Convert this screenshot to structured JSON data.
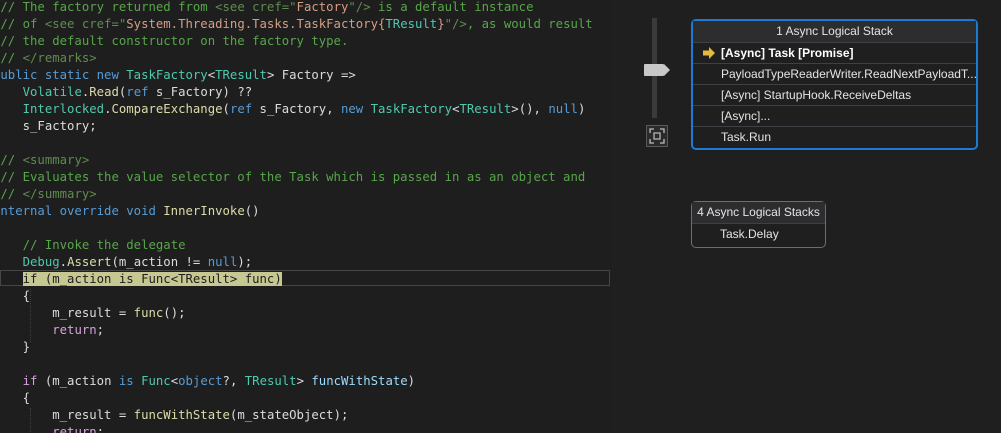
{
  "editor": {
    "lines": [
      {
        "indent": "",
        "tokens": [
          [
            "comment",
            "/// The factory returned from "
          ],
          [
            "xmltag",
            "<see cref=\""
          ],
          [
            "string",
            "Factory"
          ],
          [
            "xmltag",
            "\"/>"
          ],
          [
            "comment",
            " is a default instance"
          ]
        ]
      },
      {
        "indent": "",
        "tokens": [
          [
            "comment",
            "/// of "
          ],
          [
            "xmltag",
            "<see cref=\""
          ],
          [
            "string",
            "System.Threading.Tasks.TaskFactory{"
          ],
          [
            "type",
            "TResult"
          ],
          [
            "string",
            "}"
          ],
          [
            "xmltag",
            "\"/>"
          ],
          [
            "comment",
            ", as would result"
          ]
        ]
      },
      {
        "indent": "",
        "tokens": [
          [
            "comment",
            "/// the default constructor on the factory type."
          ]
        ]
      },
      {
        "indent": "",
        "tokens": [
          [
            "comment",
            "/// "
          ],
          [
            "xmltag",
            "</remarks>"
          ]
        ]
      },
      {
        "indent": "",
        "tokens": [
          [
            "kw",
            "public static new "
          ],
          [
            "type",
            "TaskFactory"
          ],
          [
            "plain",
            "<"
          ],
          [
            "type",
            "TResult"
          ],
          [
            "plain",
            "> Factory =>"
          ]
        ]
      },
      {
        "indent": "    ",
        "tokens": [
          [
            "type",
            "Volatile"
          ],
          [
            "plain",
            "."
          ],
          [
            "method",
            "Read"
          ],
          [
            "plain",
            "("
          ],
          [
            "kw",
            "ref"
          ],
          [
            "plain",
            " s_Factory) ??"
          ]
        ]
      },
      {
        "indent": "    ",
        "tokens": [
          [
            "type",
            "Interlocked"
          ],
          [
            "plain",
            "."
          ],
          [
            "method",
            "CompareExchange"
          ],
          [
            "plain",
            "("
          ],
          [
            "kw",
            "ref"
          ],
          [
            "plain",
            " s_Factory, "
          ],
          [
            "kw",
            "new "
          ],
          [
            "type",
            "TaskFactory"
          ],
          [
            "plain",
            "<"
          ],
          [
            "type",
            "TResult"
          ],
          [
            "plain",
            ">(), "
          ],
          [
            "kw",
            "null"
          ],
          [
            "plain",
            ")"
          ]
        ]
      },
      {
        "indent": "    ",
        "tokens": [
          [
            "plain",
            "s_Factory;"
          ]
        ]
      },
      {
        "indent": "",
        "tokens": []
      },
      {
        "indent": "",
        "tokens": [
          [
            "comment",
            "/// "
          ],
          [
            "xmltag",
            "<summary>"
          ]
        ]
      },
      {
        "indent": "",
        "tokens": [
          [
            "comment",
            "/// Evaluates the value selector of the Task which is passed in as an object and"
          ]
        ]
      },
      {
        "indent": "",
        "tokens": [
          [
            "comment",
            "/// "
          ],
          [
            "xmltag",
            "</summary>"
          ]
        ]
      },
      {
        "indent": "",
        "tokens": [
          [
            "kw",
            "internal override void "
          ],
          [
            "method",
            "InnerInvoke"
          ],
          [
            "plain",
            "()"
          ]
        ]
      },
      {
        "indent": "",
        "tokens": [
          [
            "plain",
            "{"
          ]
        ]
      },
      {
        "indent": "    ",
        "tokens": [
          [
            "comment",
            "// Invoke the delegate"
          ]
        ]
      },
      {
        "indent": "    ",
        "tokens": [
          [
            "type",
            "Debug"
          ],
          [
            "plain",
            "."
          ],
          [
            "method",
            "Assert"
          ],
          [
            "plain",
            "(m_action != "
          ],
          [
            "kw",
            "null"
          ],
          [
            "plain",
            ");"
          ]
        ]
      },
      {
        "indent": "    ",
        "tokens": [
          [
            "hl",
            "if (m_action is Func<TResult> func)"
          ]
        ]
      },
      {
        "indent": "    ",
        "tokens": [
          [
            "plain",
            "{"
          ]
        ]
      },
      {
        "indent": "        ",
        "tokens": [
          [
            "plain",
            "m_result = "
          ],
          [
            "method",
            "func"
          ],
          [
            "plain",
            "();"
          ]
        ]
      },
      {
        "indent": "        ",
        "tokens": [
          [
            "ctl",
            "return"
          ],
          [
            "plain",
            ";"
          ]
        ]
      },
      {
        "indent": "    ",
        "tokens": [
          [
            "plain",
            "}"
          ]
        ]
      },
      {
        "indent": "",
        "tokens": []
      },
      {
        "indent": "    ",
        "tokens": [
          [
            "ctl",
            "if"
          ],
          [
            "plain",
            " (m_action "
          ],
          [
            "kw",
            "is "
          ],
          [
            "type",
            "Func"
          ],
          [
            "plain",
            "<"
          ],
          [
            "kw",
            "object"
          ],
          [
            "plain",
            "?, "
          ],
          [
            "type",
            "TResult"
          ],
          [
            "plain",
            "> "
          ],
          [
            "param",
            "funcWithState"
          ],
          [
            "plain",
            ")"
          ]
        ]
      },
      {
        "indent": "    ",
        "tokens": [
          [
            "plain",
            "{"
          ]
        ]
      },
      {
        "indent": "        ",
        "tokens": [
          [
            "plain",
            "m_result = "
          ],
          [
            "method",
            "funcWithState"
          ],
          [
            "plain",
            "(m_stateObject);"
          ]
        ]
      },
      {
        "indent": "        ",
        "tokens": [
          [
            "ctl",
            "return"
          ],
          [
            "plain",
            ";"
          ]
        ]
      }
    ]
  },
  "stacks": {
    "node1": {
      "header": "1 Async Logical Stack",
      "frames": [
        {
          "label": "[Async] Task  [Promise]",
          "current": true
        },
        {
          "label": "PayloadTypeReaderWriter.ReadNextPayloadT...",
          "current": false
        },
        {
          "label": "[Async] StartupHook.ReceiveDeltas",
          "current": false
        },
        {
          "label": "[Async]...",
          "current": false
        },
        {
          "label": "Task.Run",
          "current": false
        }
      ]
    },
    "node2": {
      "header": "4 Async Logical Stacks",
      "frames": [
        {
          "label": "Task.Delay",
          "current": false
        }
      ]
    },
    "fit_icon": "fit-to-view-icon",
    "arrow_icon": "current-frame-arrow-icon",
    "colors": {
      "selected_border": "#1c7cd5",
      "node_border": "#6e6e6e",
      "arrow": "#e8b83a",
      "highlight": "#c7c792"
    }
  }
}
